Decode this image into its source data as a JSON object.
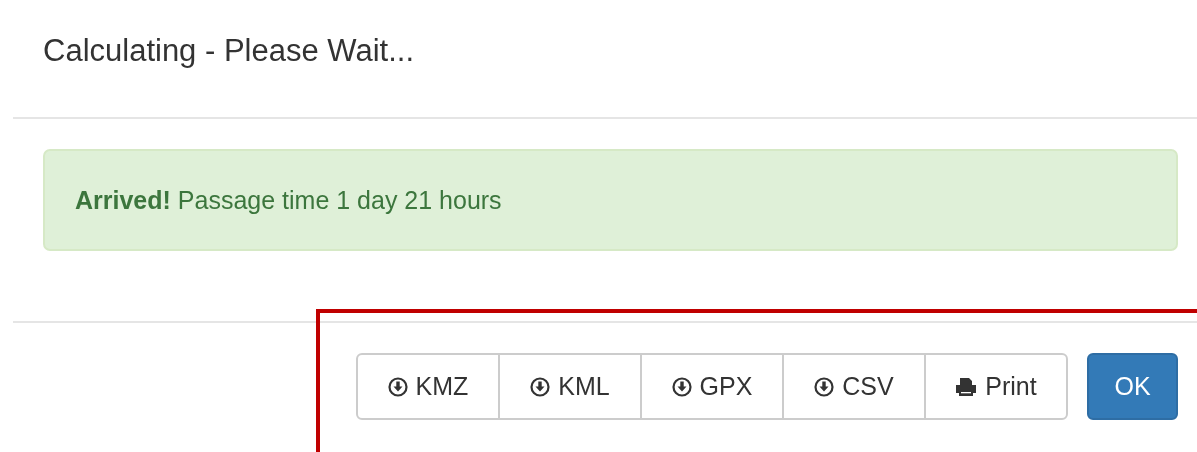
{
  "modal": {
    "title": "Calculating - Please Wait..."
  },
  "alert": {
    "strong": "Arrived!",
    "text": "Passage time 1 day 21 hours"
  },
  "export_buttons": [
    {
      "label": "KMZ",
      "kind": "download"
    },
    {
      "label": "KML",
      "kind": "download"
    },
    {
      "label": "GPX",
      "kind": "download"
    },
    {
      "label": "CSV",
      "kind": "download"
    },
    {
      "label": "Print",
      "kind": "print"
    }
  ],
  "ok_button": {
    "label": "OK"
  }
}
